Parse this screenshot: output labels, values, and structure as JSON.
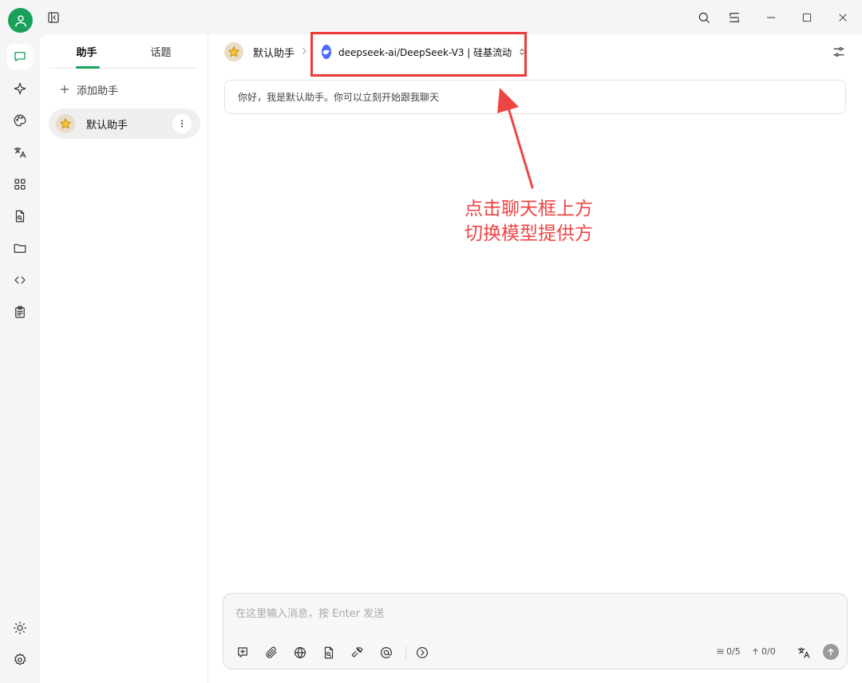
{
  "sidebar": {
    "tabs": [
      {
        "label": "助手"
      },
      {
        "label": "话题"
      }
    ],
    "add_assistant_label": "添加助手",
    "assistants": [
      {
        "name": "默认助手",
        "emoji": "⭐"
      }
    ]
  },
  "header": {
    "assistant_name": "默认助手",
    "assistant_emoji": "⭐",
    "model_label": "deepseek-ai/DeepSeek-V3 | 硅基流动"
  },
  "chat": {
    "welcome_message": "你好，我是默认助手。你可以立刻开始跟我聊天"
  },
  "annotation": {
    "line1": "点击聊天框上方",
    "line2": "切换模型提供方",
    "color": "#ee4444"
  },
  "composer": {
    "placeholder": "在这里输入消息，按 Enter 发送",
    "context_count": "0/5",
    "token_count": "0/0"
  },
  "colors": {
    "accent": "#19a15a",
    "highlight": "#ee3a3a",
    "model_logo": "#4d6bfe"
  }
}
